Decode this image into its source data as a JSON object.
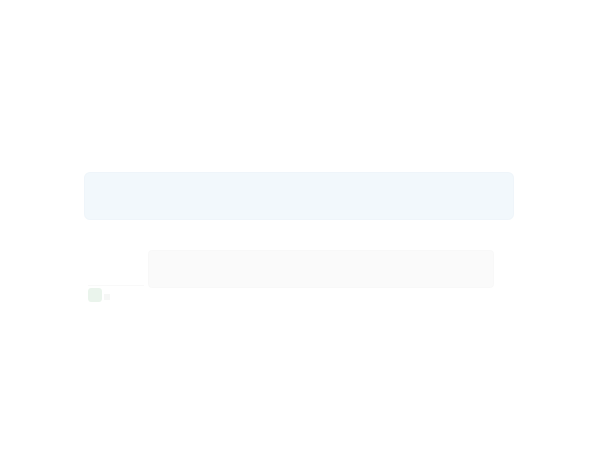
{
  "header": {
    "title": "",
    "subtitle": ""
  },
  "actions": {
    "primary_label": "",
    "secondary_label": ""
  },
  "colors": {
    "primary_button": "#bcd9ef",
    "secondary_button": "#e7e7e7",
    "status_badge": "#8fc79a",
    "background": "#ffffff"
  },
  "icons": {
    "status": "status-square-icon"
  }
}
